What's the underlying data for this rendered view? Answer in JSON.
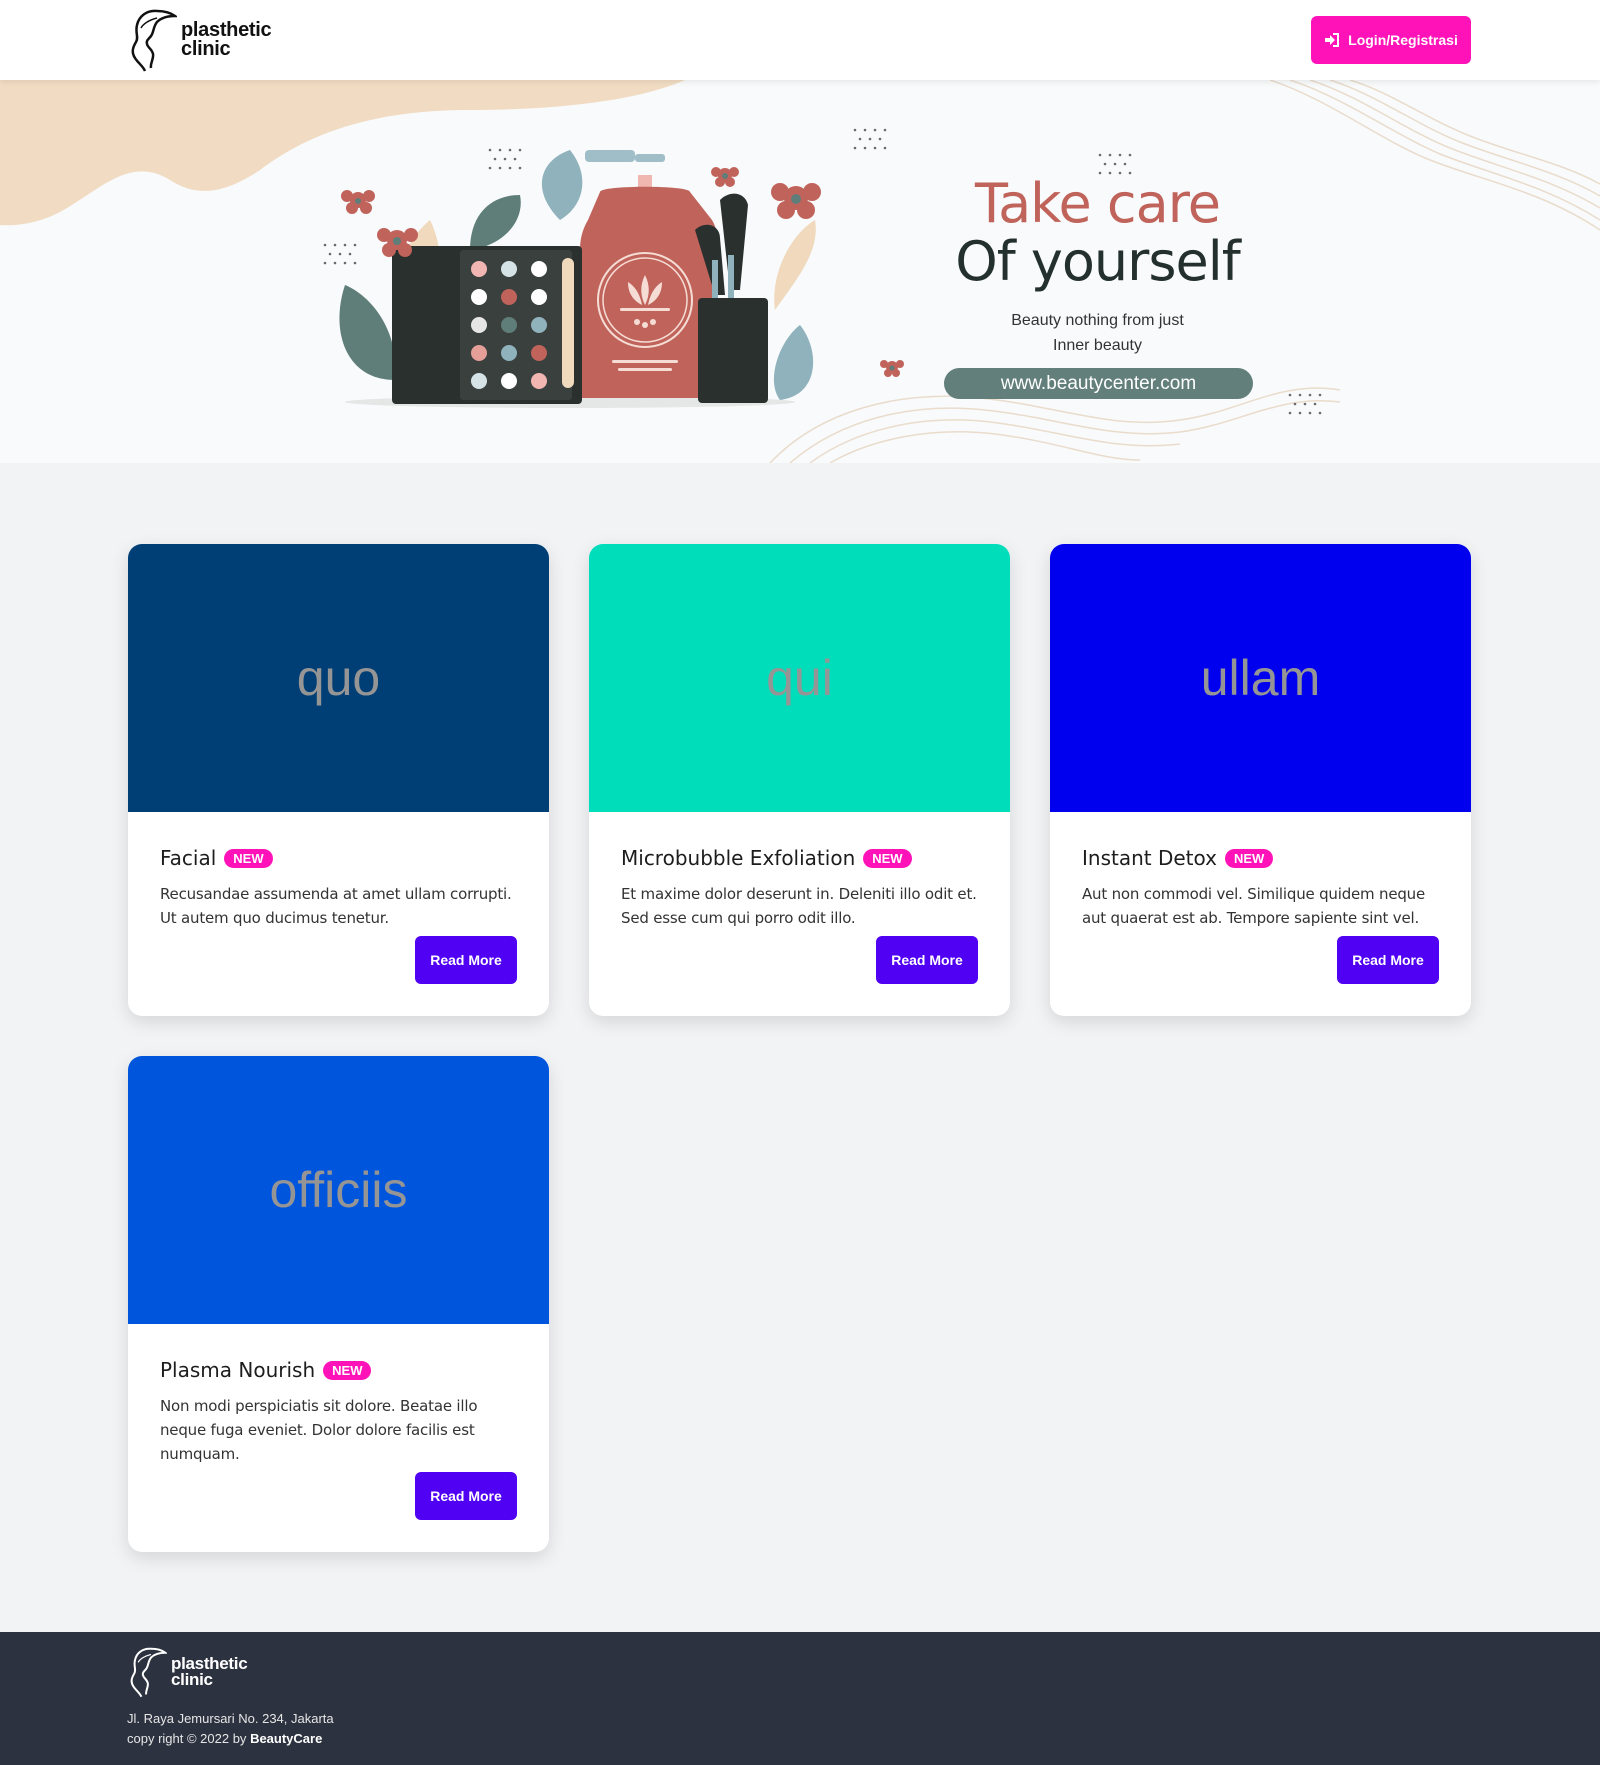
{
  "navbar": {
    "brand_line1": "plasthetic",
    "brand_line2": "clinic",
    "login_label": "Login/Registrasi",
    "login_icon": "sign-in-icon"
  },
  "hero": {
    "title_line1": "Take care",
    "title_line2": "Of yourself",
    "subtitle_line1": "Beauty nothing from just",
    "subtitle_line2": "Inner beauty",
    "url": "www.beautycenter.com"
  },
  "cards": [
    {
      "image_text": "quo",
      "image_color": "#003f75",
      "title": "Facial",
      "badge": "NEW",
      "desc": "Recusandae assumenda at amet ullam corrupti. Ut autem quo ducimus tenetur.",
      "button": "Read More"
    },
    {
      "image_text": "qui",
      "image_color": "#00ddbb",
      "title": "Microbubble Exfoliation",
      "badge": "NEW",
      "desc": "Et maxime dolor deserunt in. Deleniti illo odit et. Sed esse cum qui porro odit illo.",
      "button": "Read More"
    },
    {
      "image_text": "ullam",
      "image_color": "#0000ee",
      "title": "Instant Detox",
      "badge": "NEW",
      "desc": "Aut non commodi vel. Similique quidem neque aut quaerat est ab. Tempore sapiente sint vel.",
      "button": "Read More"
    },
    {
      "image_text": "officiis",
      "image_color": "#0055dd",
      "title": "Plasma Nourish",
      "badge": "NEW",
      "desc": "Non modi perspiciatis sit dolore. Beatae illo neque fuga eveniet. Dolor dolore facilis est numquam.",
      "button": "Read More"
    }
  ],
  "footer": {
    "brand_line1": "plasthetic",
    "brand_line2": "clinic",
    "address": "Jl. Raya Jemursari No. 234, Jakarta",
    "copyright_prefix": "copy right © 2022 by",
    "copyright_brand": "BeautyCare"
  },
  "colors": {
    "accent_pink": "#ff13b8",
    "button_purple": "#5000f2",
    "footer_bg": "#2c323f"
  }
}
